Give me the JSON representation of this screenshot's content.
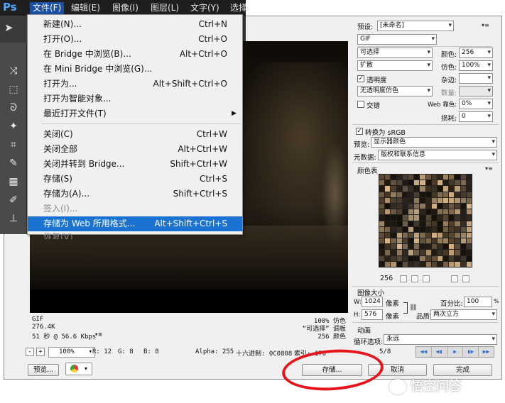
{
  "app": {
    "logo": "Ps",
    "menus": [
      "文件(F)",
      "编辑(E)",
      "图像(I)",
      "图层(L)",
      "文字(Y)",
      "选择"
    ]
  },
  "file_menu": {
    "items": [
      {
        "label": "新建(N)...",
        "shortcut": "Ctrl+N"
      },
      {
        "label": "打开(O)...",
        "shortcut": "Ctrl+O"
      },
      {
        "label": "在 Bridge 中浏览(B)...",
        "shortcut": "Alt+Ctrl+O"
      },
      {
        "label": "在 Mini Bridge 中浏览(G)...",
        "shortcut": ""
      },
      {
        "label": "打开为...",
        "shortcut": "Alt+Shift+Ctrl+O"
      },
      {
        "label": "打开为智能对象...",
        "shortcut": ""
      },
      {
        "label": "最近打开文件(T)",
        "shortcut": ""
      },
      {
        "label": "关闭(C)",
        "shortcut": "Ctrl+W"
      },
      {
        "label": "关闭全部",
        "shortcut": "Alt+Ctrl+W"
      },
      {
        "label": "关闭并转到 Bridge...",
        "shortcut": "Shift+Ctrl+W"
      },
      {
        "label": "存储(S)",
        "shortcut": "Ctrl+S"
      },
      {
        "label": "存储为(A)...",
        "shortcut": "Shift+Ctrl+S"
      },
      {
        "label": "签入(I)...",
        "shortcut": ""
      },
      {
        "label": "存储为 Web 所用格式...",
        "shortcut": "Alt+Shift+Ctrl+S"
      },
      {
        "label": "恢复(V)",
        "shortcut": ""
      }
    ]
  },
  "preview": {
    "format": "GIF",
    "size": "276.4K",
    "time": "51 秒 @ 56.6 Kbps",
    "dither": "100% 仿色",
    "palette": "“可选择” 调板",
    "colors": "256 颜色"
  },
  "status": {
    "zoom": "100%",
    "r": "R: 12",
    "g": "G: 8",
    "b": "B: 8",
    "alpha": "Alpha: 255",
    "hex": "十六进制: 0C0808",
    "index": "索引: 170",
    "frame": "5/8"
  },
  "bottom_buttons": {
    "preview": "预览...",
    "save": "存储...",
    "cancel": "取消",
    "done": "完成"
  },
  "settings": {
    "preset_label": "预设:",
    "preset_value": "[未命名]",
    "format": "GIF",
    "reduction": "可选择",
    "dither_algo": "扩散",
    "transparency": "透明度",
    "transparency_dither": "无透明度仿色",
    "interlaced": "交错",
    "colors_label": "颜色:",
    "colors_value": "256",
    "dither_label": "仿色:",
    "dither_value": "100%",
    "matte_label": "杂边:",
    "amount_label": "数量:",
    "web_snap_label": "Web 靠色:",
    "web_snap_value": "0%",
    "lossy_label": "损耗:",
    "lossy_value": "0",
    "convert_srgb": "转换为 sRGB",
    "preview_label": "预览:",
    "preview_value": "显示器颜色",
    "metadata_label": "元数据:",
    "metadata_value": "版权和联系信息"
  },
  "color_table": {
    "title": "颜色表",
    "count": "256"
  },
  "image_size": {
    "title": "图像大小",
    "w_label": "W:",
    "w_value": "1024",
    "h_label": "H:",
    "h_value": "576",
    "unit": "像素",
    "percent_label": "百分比:",
    "percent_value": "100",
    "percent_sign": "%",
    "quality_label": "品质:",
    "quality_value": "两次立方"
  },
  "animation": {
    "title": "动画",
    "loop_label": "循环选项:",
    "loop_value": "永远"
  },
  "watermark": {
    "text": "悟空问答"
  },
  "colors": {
    "highlight": "#1a73d1",
    "annotation": "#e8141b",
    "ps_blue": "#4ea6ff"
  }
}
